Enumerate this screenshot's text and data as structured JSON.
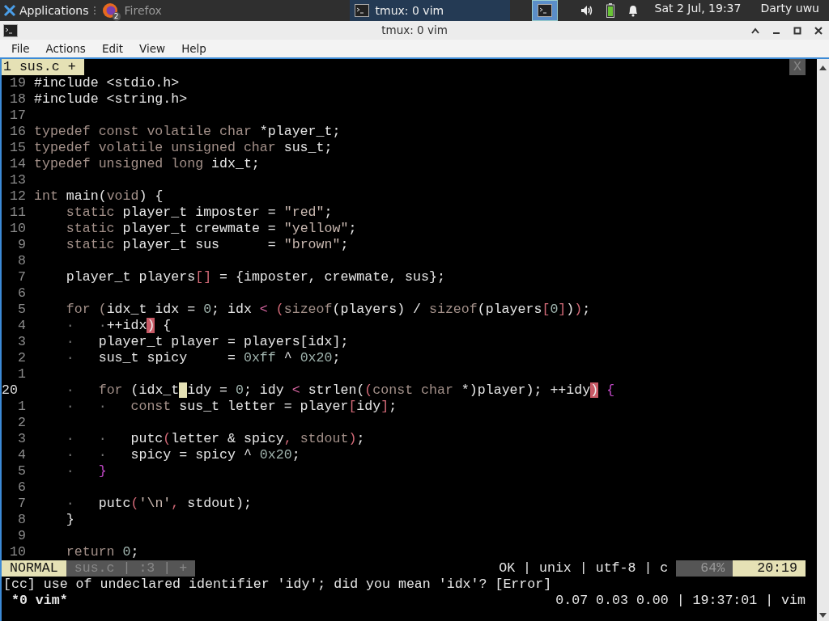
{
  "taskbar": {
    "apps_menu": "Applications",
    "tasks": [
      {
        "kind": "firefox",
        "label": "Firefox",
        "badge": "2",
        "selected": false
      },
      {
        "kind": "terminal",
        "label": "tmux: 0 vim",
        "selected": true
      }
    ],
    "clock": "Sat  2 Jul, 19:37",
    "user": "Darty uwu"
  },
  "window": {
    "title": "tmux: 0 vim"
  },
  "menu": [
    "File",
    "Actions",
    "Edit",
    "View",
    "Help"
  ],
  "vim": {
    "tabs": [
      {
        "label": "1 sus.c +",
        "selected": true
      }
    ],
    "close": "X",
    "lines": [
      {
        "number": "19",
        "current": false,
        "segments": [
          {
            "kind": "plain",
            "text": "#include <stdio.h>"
          }
        ]
      },
      {
        "number": "18",
        "current": false,
        "segments": [
          {
            "kind": "plain",
            "text": "#include <string.h>"
          }
        ]
      },
      {
        "number": "17",
        "current": false
      },
      {
        "number": "16",
        "current": false,
        "segments": [
          {
            "kind": "keyword",
            "text": "typedef const volatile char"
          },
          {
            "kind": "plain",
            "text": " *player_t;"
          }
        ]
      },
      {
        "number": "15",
        "current": false,
        "segments": [
          {
            "kind": "keyword",
            "text": "typedef volatile unsigned char"
          },
          {
            "kind": "plain",
            "text": " sus_t;"
          }
        ]
      },
      {
        "number": "14",
        "current": false,
        "segments": [
          {
            "kind": "keyword",
            "text": "typedef unsigned long"
          },
          {
            "kind": "plain",
            "text": " idx_t;"
          }
        ]
      },
      {
        "number": "13",
        "current": false
      },
      {
        "number": "12",
        "current": false,
        "segments": [
          {
            "kind": "keyword",
            "text": "int"
          },
          {
            "kind": "plain",
            "text": " main("
          },
          {
            "kind": "keyword",
            "text": "void"
          },
          {
            "kind": "plain",
            "text": ") {"
          }
        ]
      },
      {
        "number": "11",
        "current": false,
        "segments": [
          {
            "kind": "keyword",
            "text": "    static"
          },
          {
            "kind": "plain",
            "text": " player_t imposter = "
          },
          {
            "kind": "string",
            "text": "\"red\""
          },
          {
            "kind": "plain",
            "text": ";"
          }
        ]
      },
      {
        "number": "10",
        "current": false,
        "segments": [
          {
            "kind": "keyword",
            "text": "    static"
          },
          {
            "kind": "plain",
            "text": " player_t crewmate = "
          },
          {
            "kind": "string",
            "text": "\"yellow\""
          },
          {
            "kind": "plain",
            "text": ";"
          }
        ]
      },
      {
        "number": "9",
        "current": false,
        "segments": [
          {
            "kind": "keyword",
            "text": "    static"
          },
          {
            "kind": "plain",
            "text": " player_t sus      = "
          },
          {
            "kind": "string",
            "text": "\"brown\""
          },
          {
            "kind": "plain",
            "text": ";"
          }
        ]
      },
      {
        "number": "8",
        "current": false
      },
      {
        "number": "7",
        "current": false,
        "segments": [
          {
            "kind": "plain",
            "text": "    player_t players"
          },
          {
            "kind": "bracket",
            "text": "[]"
          },
          {
            "kind": "plain",
            "text": " = {imposter, crewmate, sus};"
          }
        ]
      },
      {
        "number": "6",
        "current": false
      },
      {
        "number": "5",
        "current": false,
        "segments": [
          {
            "kind": "keyword",
            "text": "    for ("
          },
          {
            "kind": "plain",
            "text": "idx_t idx = "
          },
          {
            "kind": "number",
            "text": "0"
          },
          {
            "kind": "plain",
            "text": "; idx "
          },
          {
            "kind": "operator",
            "text": "< "
          },
          {
            "kind": "bracket",
            "text": "("
          },
          {
            "kind": "keyword",
            "text": "sizeof"
          },
          {
            "kind": "plain",
            "text": "(players) / "
          },
          {
            "kind": "keyword",
            "text": "sizeof"
          },
          {
            "kind": "plain",
            "text": "(players"
          },
          {
            "kind": "bracket",
            "text": "["
          },
          {
            "kind": "number",
            "text": "0"
          },
          {
            "kind": "bracket",
            "text": "]"
          },
          {
            "kind": "plain",
            "text": ")"
          },
          {
            "kind": "bracket",
            "text": ")"
          },
          {
            "kind": "plain",
            "text": ";"
          }
        ]
      },
      {
        "number": "4",
        "current": false,
        "segments": [
          {
            "kind": "guide",
            "text": "    ·   ·"
          },
          {
            "kind": "plain",
            "text": "++idx"
          },
          {
            "kind": "match",
            "text": ")"
          },
          {
            "kind": "plain",
            "text": " {"
          }
        ]
      },
      {
        "number": "3",
        "current": false,
        "segments": [
          {
            "kind": "guide",
            "text": "    ·   "
          },
          {
            "kind": "plain",
            "text": "player_t player = players[idx];"
          }
        ]
      },
      {
        "number": "2",
        "current": false,
        "segments": [
          {
            "kind": "guide",
            "text": "    ·   "
          },
          {
            "kind": "plain",
            "text": "sus_t spicy     = "
          },
          {
            "kind": "number",
            "text": "0xff"
          },
          {
            "kind": "plain",
            "text": " ^ "
          },
          {
            "kind": "number",
            "text": "0x20"
          },
          {
            "kind": "plain",
            "text": ";"
          }
        ]
      },
      {
        "number": "1",
        "current": false
      },
      {
        "number": "20",
        "current": true,
        "segments": [
          {
            "kind": "guide",
            "text": "    ·   "
          },
          {
            "kind": "keyword",
            "text": "for"
          },
          {
            "kind": "plain",
            "text": " (idx_t"
          },
          {
            "kind": "cursor"
          },
          {
            "kind": "plain",
            "text": "idy = "
          },
          {
            "kind": "number",
            "text": "0"
          },
          {
            "kind": "plain",
            "text": "; idy "
          },
          {
            "kind": "operator",
            "text": "<"
          },
          {
            "kind": "plain",
            "text": " strlen("
          },
          {
            "kind": "bracket",
            "text": "("
          },
          {
            "kind": "keyword",
            "text": "const char"
          },
          {
            "kind": "plain",
            "text": " *)player); ++idy"
          },
          {
            "kind": "match",
            "text": ")"
          },
          {
            "kind": "brace",
            "text": " {"
          }
        ]
      },
      {
        "number": "1",
        "current": false,
        "segments": [
          {
            "kind": "guide",
            "text": "    ·   ·   "
          },
          {
            "kind": "keyword",
            "text": "const"
          },
          {
            "kind": "plain",
            "text": " sus_t letter = player"
          },
          {
            "kind": "bracket",
            "text": "["
          },
          {
            "kind": "plain",
            "text": "idy"
          },
          {
            "kind": "bracket",
            "text": "]"
          },
          {
            "kind": "plain",
            "text": ";"
          }
        ]
      },
      {
        "number": "2",
        "current": false
      },
      {
        "number": "3",
        "current": false,
        "segments": [
          {
            "kind": "guide",
            "text": "    ·   ·   "
          },
          {
            "kind": "plain",
            "text": "putc"
          },
          {
            "kind": "bracket",
            "text": "("
          },
          {
            "kind": "plain",
            "text": "letter & spicy"
          },
          {
            "kind": "bracket",
            "text": ","
          },
          {
            "kind": "keyword",
            "text": " stdout"
          },
          {
            "kind": "bracket",
            "text": ")"
          },
          {
            "kind": "plain",
            "text": ";"
          }
        ]
      },
      {
        "number": "4",
        "current": false,
        "segments": [
          {
            "kind": "guide",
            "text": "    ·   ·   "
          },
          {
            "kind": "plain",
            "text": "spicy = spicy ^ "
          },
          {
            "kind": "number",
            "text": "0x20"
          },
          {
            "kind": "plain",
            "text": ";"
          }
        ]
      },
      {
        "number": "5",
        "current": false,
        "segments": [
          {
            "kind": "guide",
            "text": "    ·   "
          },
          {
            "kind": "brace",
            "text": "}"
          }
        ]
      },
      {
        "number": "6",
        "current": false
      },
      {
        "number": "7",
        "current": false,
        "segments": [
          {
            "kind": "guide",
            "text": "    ·   "
          },
          {
            "kind": "plain",
            "text": "putc"
          },
          {
            "kind": "bracket",
            "text": "("
          },
          {
            "kind": "string",
            "text": "'\\n'"
          },
          {
            "kind": "bracket",
            "text": ","
          },
          {
            "kind": "plain",
            "text": " stdout);"
          }
        ]
      },
      {
        "number": "8",
        "current": false,
        "segments": [
          {
            "kind": "plain",
            "text": "    }"
          }
        ]
      },
      {
        "number": "9",
        "current": false
      },
      {
        "number": "10",
        "current": false,
        "segments": [
          {
            "kind": "keyword",
            "text": "    return "
          },
          {
            "kind": "number",
            "text": "0"
          },
          {
            "kind": "plain",
            "text": ";"
          }
        ]
      }
    ],
    "statusline": {
      "mode": "NORMAL",
      "file": "sus.c | :3 | +",
      "info": "OK | unix | utf-8 | c",
      "percent": "64%",
      "position": "20:19"
    },
    "message": "[cc] use of undeclared identifier 'idy'; did you mean 'idx'? [Error]"
  },
  "tmux": {
    "window": "*0 vim*",
    "status": "0.07 0.03 0.00 | 19:37:01 | vim"
  }
}
